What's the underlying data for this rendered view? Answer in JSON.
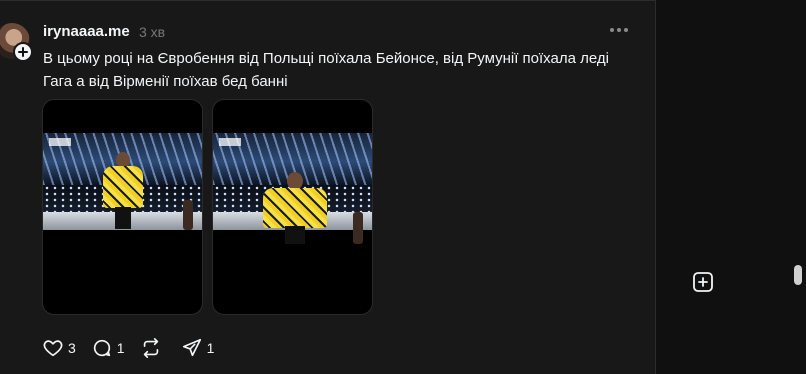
{
  "post": {
    "username": "irynaaaa.me",
    "time": "3 хв",
    "text": "В цьому році на Євробення від Польщі поїхала Бейонсе, від Румунії поїхала леді Гага а від Вірменії поїхав бед банні"
  },
  "actions": {
    "likes": "3",
    "replies": "1",
    "reposts": "",
    "shares": "1"
  },
  "icons": {
    "more": "more-dots-icon",
    "like": "heart-icon",
    "reply": "comment-icon",
    "repost": "repost-icon",
    "share": "send-icon",
    "create": "new-post-icon",
    "follow": "plus-icon"
  }
}
